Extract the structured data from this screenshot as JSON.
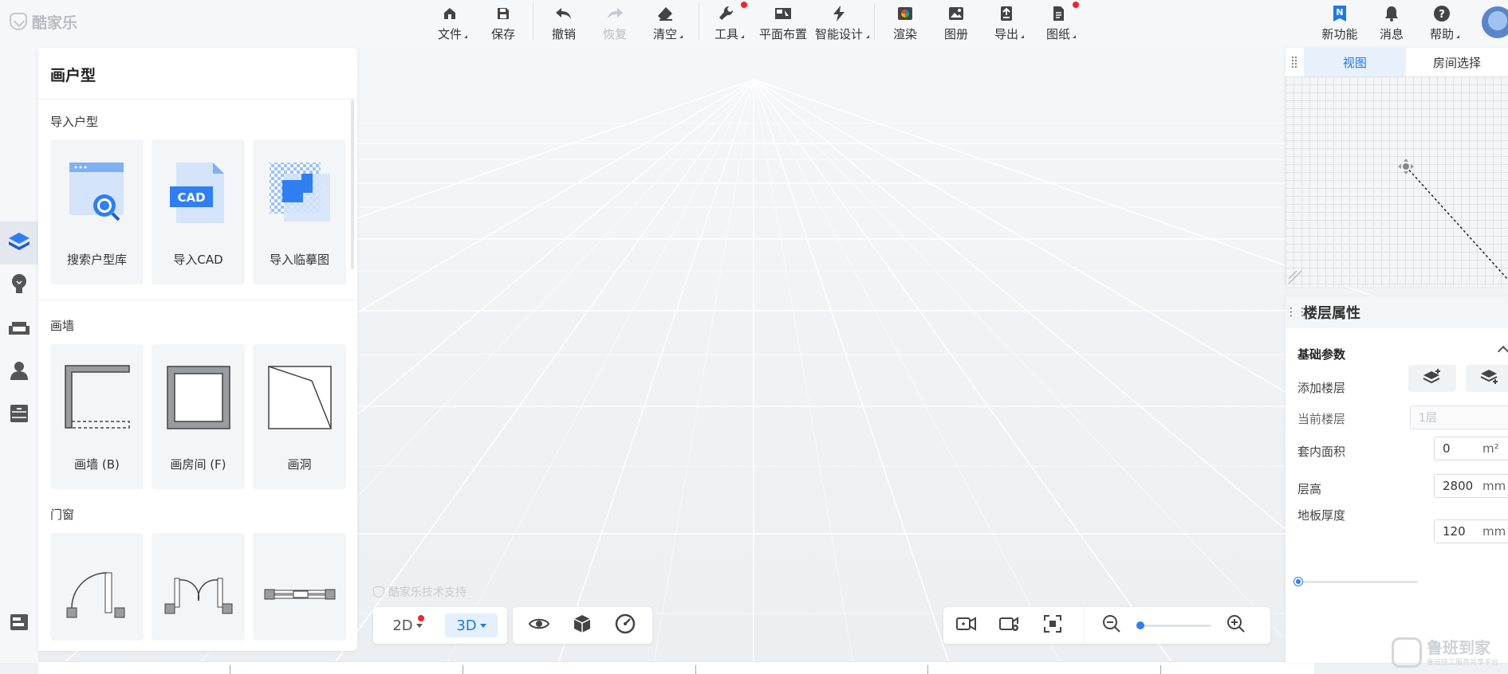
{
  "app": {
    "logo_text": "酷家乐"
  },
  "toolbar": {
    "file": "文件",
    "save": "保存",
    "undo": "撤销",
    "redo": "恢复",
    "clear": "清空",
    "tools": "工具",
    "layout": "平面布置",
    "smart_design": "智能设计",
    "render": "渲染",
    "album": "图册",
    "export": "导出",
    "drawings": "图纸",
    "new_features": "新功能",
    "messages": "消息",
    "help": "帮助"
  },
  "rail": {
    "items": [
      "floorplan",
      "lighting",
      "furniture",
      "user",
      "cabinet",
      "collapse"
    ]
  },
  "panel": {
    "title": "画户型",
    "import": {
      "title": "导入户型",
      "items": [
        "搜索户型库",
        "导入CAD",
        "导入临摹图"
      ],
      "cad_badge": "CAD"
    },
    "walls": {
      "title": "画墙",
      "items": [
        "画墙 (B)",
        "画房间 (F)",
        "画洞"
      ]
    },
    "doors": {
      "title": "门窗"
    }
  },
  "viewport": {
    "watermark": "酷家乐技术支持",
    "mode_2d": "2D",
    "mode_3d": "3D",
    "active_mode": "3D",
    "zoom_level": 0.0
  },
  "minimap": {
    "tabs": [
      "视图",
      "房间选择"
    ],
    "active_tab": "视图"
  },
  "props": {
    "title": "楼层属性",
    "group": "基础参数",
    "add_floor_label": "添加楼层",
    "current_floor_label": "当前楼层",
    "current_floor_value": "1层",
    "inner_area_label": "套内面积",
    "inner_area_value": "0",
    "inner_area_unit": "m²",
    "floor_height_label": "层高",
    "floor_height_value": "2800",
    "floor_height_unit": "mm",
    "slab_label": "地板厚度",
    "slab_value": "120",
    "slab_unit": "mm",
    "slab_slider": 0.0
  },
  "brand_watermark": {
    "name": "鲁班到家",
    "sub": "鲁班技工服务共享平台"
  },
  "colors": {
    "accent": "#1f7ae0",
    "notify": "#f5222d"
  }
}
